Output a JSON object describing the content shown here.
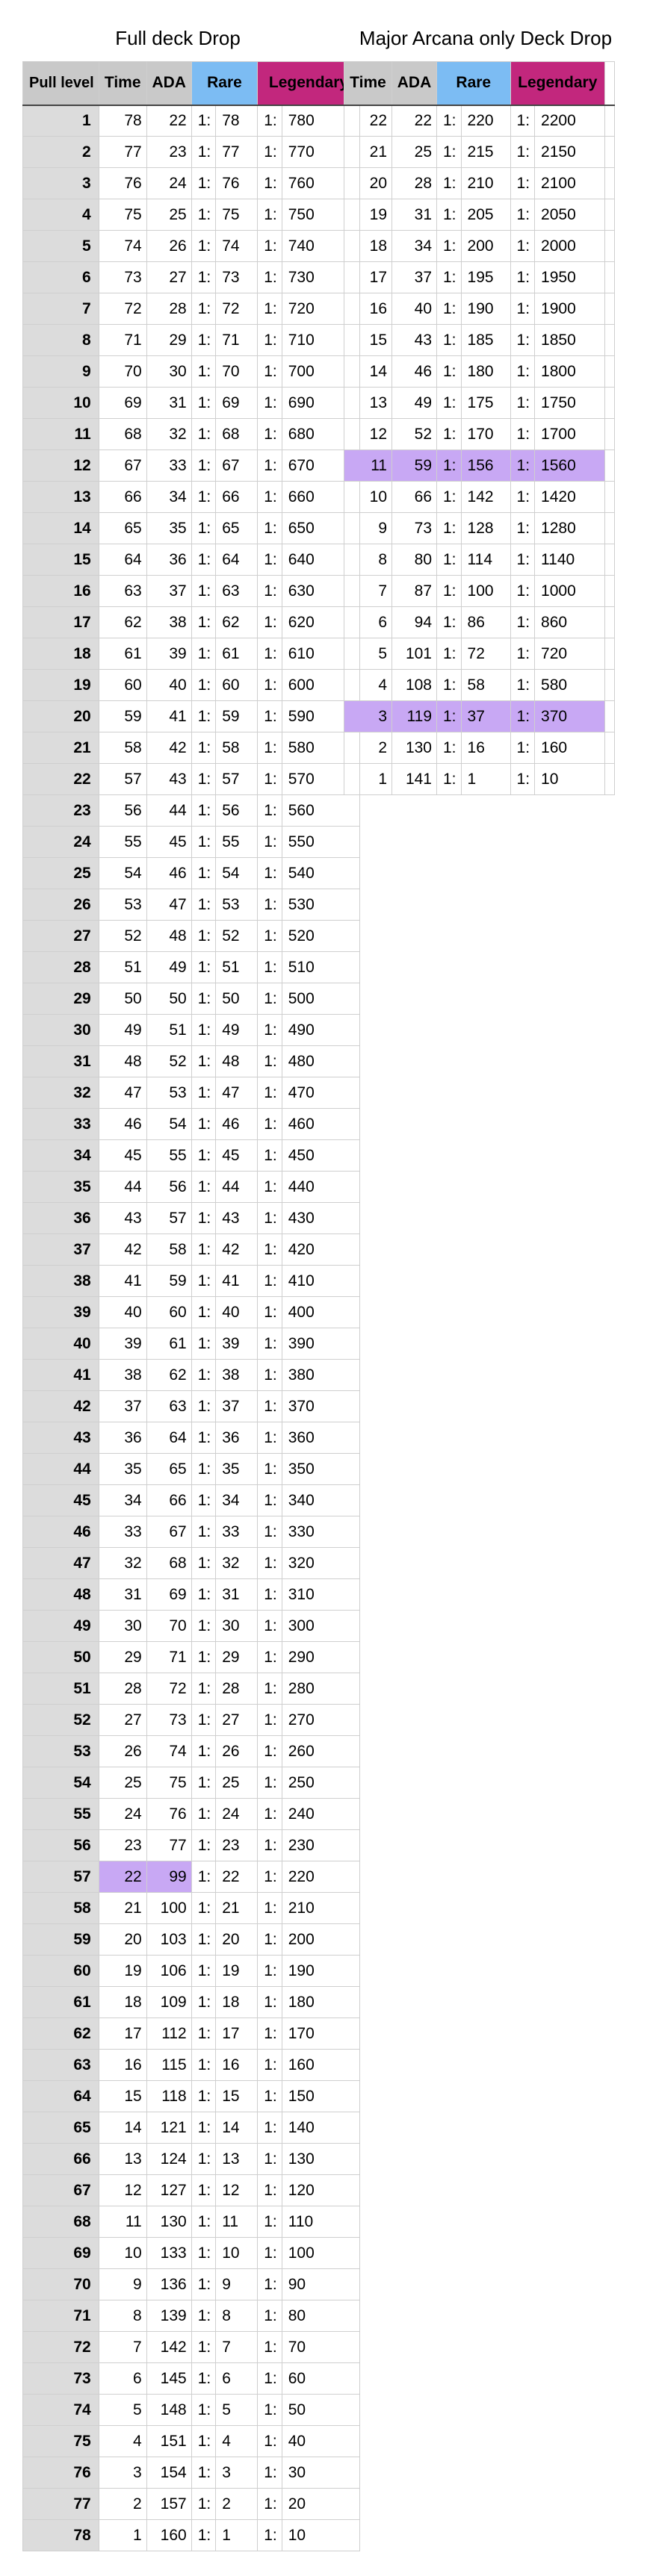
{
  "left_title": "Full deck Drop",
  "right_title": "Major Arcana only Deck Drop",
  "headers": {
    "pull_level": "Pull level",
    "time": "Time",
    "ada": "ADA",
    "rare": "Rare",
    "legendary": "Legendary"
  },
  "prefix": "1:",
  "colors": {
    "header_gray": "#c9c9c9",
    "rare_blue": "#7cbcf3",
    "legendary_magenta": "#c2277d",
    "highlight_purple": "#c8a8f4",
    "level_gray": "#dcdcdc"
  },
  "full_deck": [
    {
      "level": "1",
      "time": "78",
      "ada": "22",
      "rare": "78",
      "legendary": "780"
    },
    {
      "level": "2",
      "time": "77",
      "ada": "23",
      "rare": "77",
      "legendary": "770"
    },
    {
      "level": "3",
      "time": "76",
      "ada": "24",
      "rare": "76",
      "legendary": "760"
    },
    {
      "level": "4",
      "time": "75",
      "ada": "25",
      "rare": "75",
      "legendary": "750"
    },
    {
      "level": "5",
      "time": "74",
      "ada": "26",
      "rare": "74",
      "legendary": "740"
    },
    {
      "level": "6",
      "time": "73",
      "ada": "27",
      "rare": "73",
      "legendary": "730"
    },
    {
      "level": "7",
      "time": "72",
      "ada": "28",
      "rare": "72",
      "legendary": "720"
    },
    {
      "level": "8",
      "time": "71",
      "ada": "29",
      "rare": "71",
      "legendary": "710"
    },
    {
      "level": "9",
      "time": "70",
      "ada": "30",
      "rare": "70",
      "legendary": "700"
    },
    {
      "level": "10",
      "time": "69",
      "ada": "31",
      "rare": "69",
      "legendary": "690"
    },
    {
      "level": "11",
      "time": "68",
      "ada": "32",
      "rare": "68",
      "legendary": "680"
    },
    {
      "level": "12",
      "time": "67",
      "ada": "33",
      "rare": "67",
      "legendary": "670"
    },
    {
      "level": "13",
      "time": "66",
      "ada": "34",
      "rare": "66",
      "legendary": "660"
    },
    {
      "level": "14",
      "time": "65",
      "ada": "35",
      "rare": "65",
      "legendary": "650"
    },
    {
      "level": "15",
      "time": "64",
      "ada": "36",
      "rare": "64",
      "legendary": "640"
    },
    {
      "level": "16",
      "time": "63",
      "ada": "37",
      "rare": "63",
      "legendary": "630"
    },
    {
      "level": "17",
      "time": "62",
      "ada": "38",
      "rare": "62",
      "legendary": "620"
    },
    {
      "level": "18",
      "time": "61",
      "ada": "39",
      "rare": "61",
      "legendary": "610"
    },
    {
      "level": "19",
      "time": "60",
      "ada": "40",
      "rare": "60",
      "legendary": "600"
    },
    {
      "level": "20",
      "time": "59",
      "ada": "41",
      "rare": "59",
      "legendary": "590"
    },
    {
      "level": "21",
      "time": "58",
      "ada": "42",
      "rare": "58",
      "legendary": "580"
    },
    {
      "level": "22",
      "time": "57",
      "ada": "43",
      "rare": "57",
      "legendary": "570"
    },
    {
      "level": "23",
      "time": "56",
      "ada": "44",
      "rare": "56",
      "legendary": "560"
    },
    {
      "level": "24",
      "time": "55",
      "ada": "45",
      "rare": "55",
      "legendary": "550"
    },
    {
      "level": "25",
      "time": "54",
      "ada": "46",
      "rare": "54",
      "legendary": "540"
    },
    {
      "level": "26",
      "time": "53",
      "ada": "47",
      "rare": "53",
      "legendary": "530"
    },
    {
      "level": "27",
      "time": "52",
      "ada": "48",
      "rare": "52",
      "legendary": "520"
    },
    {
      "level": "28",
      "time": "51",
      "ada": "49",
      "rare": "51",
      "legendary": "510"
    },
    {
      "level": "29",
      "time": "50",
      "ada": "50",
      "rare": "50",
      "legendary": "500"
    },
    {
      "level": "30",
      "time": "49",
      "ada": "51",
      "rare": "49",
      "legendary": "490"
    },
    {
      "level": "31",
      "time": "48",
      "ada": "52",
      "rare": "48",
      "legendary": "480"
    },
    {
      "level": "32",
      "time": "47",
      "ada": "53",
      "rare": "47",
      "legendary": "470"
    },
    {
      "level": "33",
      "time": "46",
      "ada": "54",
      "rare": "46",
      "legendary": "460"
    },
    {
      "level": "34",
      "time": "45",
      "ada": "55",
      "rare": "45",
      "legendary": "450"
    },
    {
      "level": "35",
      "time": "44",
      "ada": "56",
      "rare": "44",
      "legendary": "440"
    },
    {
      "level": "36",
      "time": "43",
      "ada": "57",
      "rare": "43",
      "legendary": "430"
    },
    {
      "level": "37",
      "time": "42",
      "ada": "58",
      "rare": "42",
      "legendary": "420"
    },
    {
      "level": "38",
      "time": "41",
      "ada": "59",
      "rare": "41",
      "legendary": "410"
    },
    {
      "level": "39",
      "time": "40",
      "ada": "60",
      "rare": "40",
      "legendary": "400"
    },
    {
      "level": "40",
      "time": "39",
      "ada": "61",
      "rare": "39",
      "legendary": "390"
    },
    {
      "level": "41",
      "time": "38",
      "ada": "62",
      "rare": "38",
      "legendary": "380"
    },
    {
      "level": "42",
      "time": "37",
      "ada": "63",
      "rare": "37",
      "legendary": "370"
    },
    {
      "level": "43",
      "time": "36",
      "ada": "64",
      "rare": "36",
      "legendary": "360"
    },
    {
      "level": "44",
      "time": "35",
      "ada": "65",
      "rare": "35",
      "legendary": "350"
    },
    {
      "level": "45",
      "time": "34",
      "ada": "66",
      "rare": "34",
      "legendary": "340"
    },
    {
      "level": "46",
      "time": "33",
      "ada": "67",
      "rare": "33",
      "legendary": "330"
    },
    {
      "level": "47",
      "time": "32",
      "ada": "68",
      "rare": "32",
      "legendary": "320"
    },
    {
      "level": "48",
      "time": "31",
      "ada": "69",
      "rare": "31",
      "legendary": "310"
    },
    {
      "level": "49",
      "time": "30",
      "ada": "70",
      "rare": "30",
      "legendary": "300"
    },
    {
      "level": "50",
      "time": "29",
      "ada": "71",
      "rare": "29",
      "legendary": "290"
    },
    {
      "level": "51",
      "time": "28",
      "ada": "72",
      "rare": "28",
      "legendary": "280"
    },
    {
      "level": "52",
      "time": "27",
      "ada": "73",
      "rare": "27",
      "legendary": "270"
    },
    {
      "level": "53",
      "time": "26",
      "ada": "74",
      "rare": "26",
      "legendary": "260"
    },
    {
      "level": "54",
      "time": "25",
      "ada": "75",
      "rare": "25",
      "legendary": "250"
    },
    {
      "level": "55",
      "time": "24",
      "ada": "76",
      "rare": "24",
      "legendary": "240"
    },
    {
      "level": "56",
      "time": "23",
      "ada": "77",
      "rare": "23",
      "legendary": "230"
    },
    {
      "level": "57",
      "time": "22",
      "ada": "99",
      "rare": "22",
      "legendary": "220",
      "highlight": "time_ada"
    },
    {
      "level": "58",
      "time": "21",
      "ada": "100",
      "rare": "21",
      "legendary": "210"
    },
    {
      "level": "59",
      "time": "20",
      "ada": "103",
      "rare": "20",
      "legendary": "200"
    },
    {
      "level": "60",
      "time": "19",
      "ada": "106",
      "rare": "19",
      "legendary": "190"
    },
    {
      "level": "61",
      "time": "18",
      "ada": "109",
      "rare": "18",
      "legendary": "180"
    },
    {
      "level": "62",
      "time": "17",
      "ada": "112",
      "rare": "17",
      "legendary": "170"
    },
    {
      "level": "63",
      "time": "16",
      "ada": "115",
      "rare": "16",
      "legendary": "160"
    },
    {
      "level": "64",
      "time": "15",
      "ada": "118",
      "rare": "15",
      "legendary": "150"
    },
    {
      "level": "65",
      "time": "14",
      "ada": "121",
      "rare": "14",
      "legendary": "140"
    },
    {
      "level": "66",
      "time": "13",
      "ada": "124",
      "rare": "13",
      "legendary": "130"
    },
    {
      "level": "67",
      "time": "12",
      "ada": "127",
      "rare": "12",
      "legendary": "120"
    },
    {
      "level": "68",
      "time": "11",
      "ada": "130",
      "rare": "11",
      "legendary": "110"
    },
    {
      "level": "69",
      "time": "10",
      "ada": "133",
      "rare": "10",
      "legendary": "100"
    },
    {
      "level": "70",
      "time": "9",
      "ada": "136",
      "rare": "9",
      "legendary": "90"
    },
    {
      "level": "71",
      "time": "8",
      "ada": "139",
      "rare": "8",
      "legendary": "80"
    },
    {
      "level": "72",
      "time": "7",
      "ada": "142",
      "rare": "7",
      "legendary": "70"
    },
    {
      "level": "73",
      "time": "6",
      "ada": "145",
      "rare": "6",
      "legendary": "60"
    },
    {
      "level": "74",
      "time": "5",
      "ada": "148",
      "rare": "5",
      "legendary": "50"
    },
    {
      "level": "75",
      "time": "4",
      "ada": "151",
      "rare": "4",
      "legendary": "40"
    },
    {
      "level": "76",
      "time": "3",
      "ada": "154",
      "rare": "3",
      "legendary": "30"
    },
    {
      "level": "77",
      "time": "2",
      "ada": "157",
      "rare": "2",
      "legendary": "20"
    },
    {
      "level": "78",
      "time": "1",
      "ada": "160",
      "rare": "1",
      "legendary": "10"
    }
  ],
  "major_arcana": [
    {
      "time": "22",
      "ada": "22",
      "rare": "220",
      "legendary": "2200"
    },
    {
      "time": "21",
      "ada": "25",
      "rare": "215",
      "legendary": "2150"
    },
    {
      "time": "20",
      "ada": "28",
      "rare": "210",
      "legendary": "2100"
    },
    {
      "time": "19",
      "ada": "31",
      "rare": "205",
      "legendary": "2050"
    },
    {
      "time": "18",
      "ada": "34",
      "rare": "200",
      "legendary": "2000"
    },
    {
      "time": "17",
      "ada": "37",
      "rare": "195",
      "legendary": "1950"
    },
    {
      "time": "16",
      "ada": "40",
      "rare": "190",
      "legendary": "1900"
    },
    {
      "time": "15",
      "ada": "43",
      "rare": "185",
      "legendary": "1850"
    },
    {
      "time": "14",
      "ada": "46",
      "rare": "180",
      "legendary": "1800"
    },
    {
      "time": "13",
      "ada": "49",
      "rare": "175",
      "legendary": "1750"
    },
    {
      "time": "12",
      "ada": "52",
      "rare": "170",
      "legendary": "1700"
    },
    {
      "time": "11",
      "ada": "59",
      "rare": "156",
      "legendary": "1560",
      "highlight": "row"
    },
    {
      "time": "10",
      "ada": "66",
      "rare": "142",
      "legendary": "1420"
    },
    {
      "time": "9",
      "ada": "73",
      "rare": "128",
      "legendary": "1280"
    },
    {
      "time": "8",
      "ada": "80",
      "rare": "114",
      "legendary": "1140"
    },
    {
      "time": "7",
      "ada": "87",
      "rare": "100",
      "legendary": "1000"
    },
    {
      "time": "6",
      "ada": "94",
      "rare": "86",
      "legendary": "860"
    },
    {
      "time": "5",
      "ada": "101",
      "rare": "72",
      "legendary": "720"
    },
    {
      "time": "4",
      "ada": "108",
      "rare": "58",
      "legendary": "580"
    },
    {
      "time": "3",
      "ada": "119",
      "rare": "37",
      "legendary": "370",
      "highlight": "row"
    },
    {
      "time": "2",
      "ada": "130",
      "rare": "16",
      "legendary": "160"
    },
    {
      "time": "1",
      "ada": "141",
      "rare": "1",
      "legendary": "10"
    }
  ]
}
